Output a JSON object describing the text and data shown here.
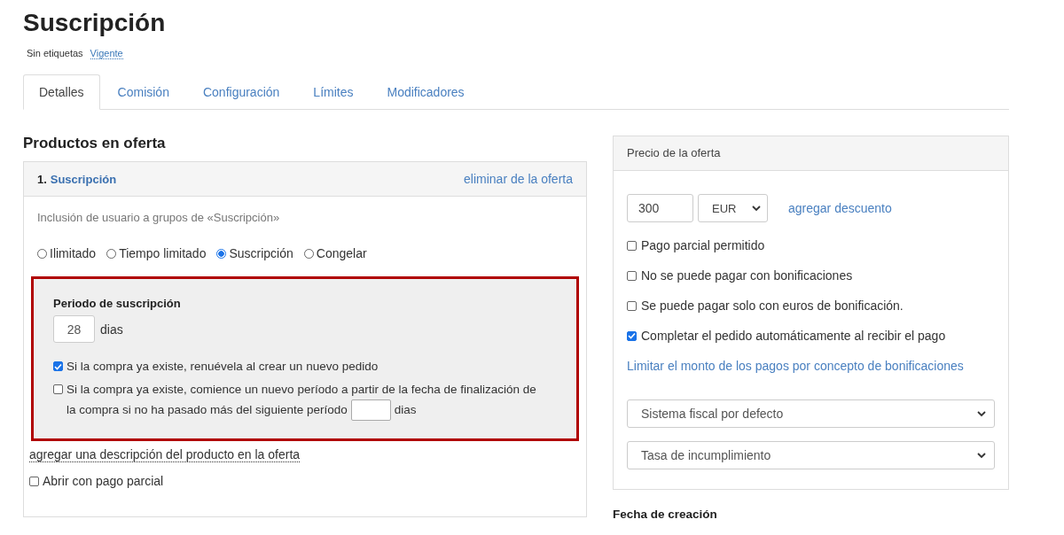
{
  "header": {
    "title": "Suscripción",
    "tags_label": "Sin etiquetas",
    "status_link": "Vigente"
  },
  "tabs": [
    {
      "label": "Detalles",
      "selected": true
    },
    {
      "label": "Comisión",
      "selected": false
    },
    {
      "label": "Configuración",
      "selected": false
    },
    {
      "label": "Límites",
      "selected": false
    },
    {
      "label": "Modificadores",
      "selected": false
    }
  ],
  "products": {
    "heading": "Productos en oferta",
    "product": {
      "number": "1.",
      "name": "Suscripción",
      "remove_link": "eliminar de la oferta",
      "description": "Inclusión de usuario a grupos de «Suscripción»",
      "access_types": [
        {
          "label": "Ilimitado",
          "selected": false
        },
        {
          "label": "Tiempo limitado",
          "selected": false
        },
        {
          "label": "Suscripción",
          "selected": true
        },
        {
          "label": "Congelar",
          "selected": false
        }
      ],
      "subscription_panel": {
        "heading": "Periodo de suscripción",
        "period_value": "28",
        "period_unit": "dias",
        "options": [
          {
            "text": "Si la compra ya existe, renuévela al crear un nuevo pedido",
            "checked": true
          },
          {
            "text": "Si la compra ya existe, comience un nuevo período a partir de la fecha de finalización de",
            "text_2": "la compra si no ha pasado más del siguiente período",
            "checked": false,
            "unit": "dias"
          }
        ]
      },
      "add_description_link": "agregar una descripción del producto en la oferta",
      "open_partial": {
        "label": "Abrir con pago parcial",
        "checked": false
      }
    }
  },
  "price": {
    "heading": "Precio de la oferta",
    "amount": "300",
    "currency": "EUR",
    "discount_link": "agregar descuento",
    "options": [
      {
        "label": "Pago parcial permitido",
        "checked": false
      },
      {
        "label": "No se puede pagar con bonificaciones",
        "checked": false
      },
      {
        "label": "Se puede pagar solo con euros de bonificación.",
        "checked": false
      },
      {
        "label": "Completar el pedido automáticamente al recibir el pago",
        "checked": true
      }
    ],
    "limit_link": "Limitar el monto de los pagos por concepto de bonificaciones",
    "selects": [
      "Sistema fiscal por defecto",
      "Tasa de incumplimiento"
    ]
  },
  "creation_date": {
    "heading": "Fecha de creación"
  }
}
